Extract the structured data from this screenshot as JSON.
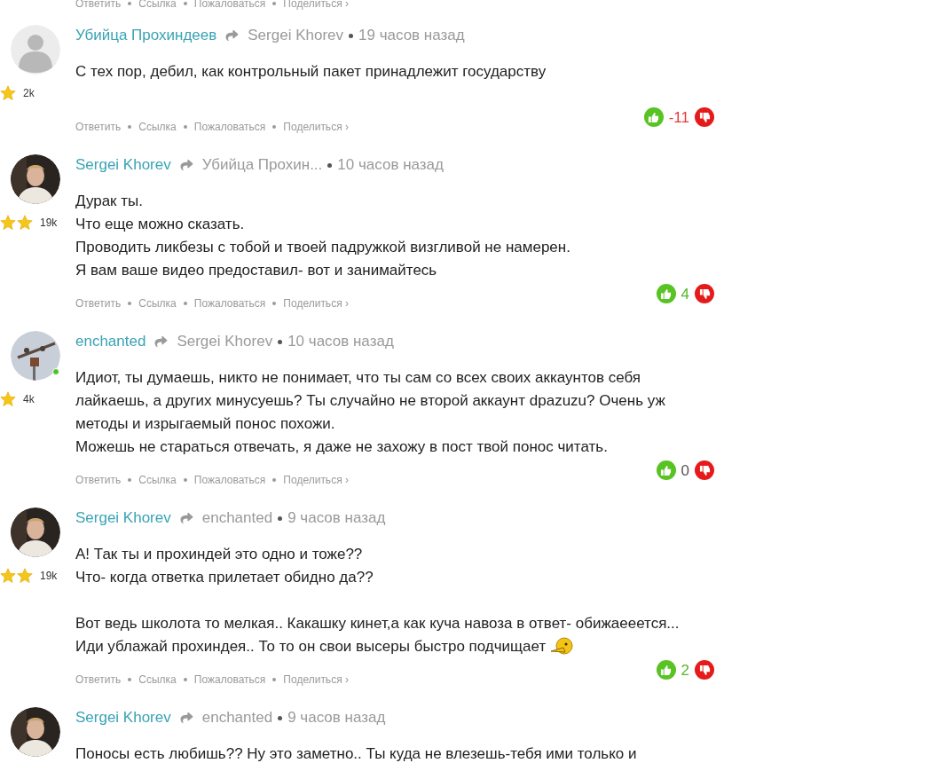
{
  "top_actions": [
    "Ответить",
    "Ссылка",
    "Пожаловаться",
    "Поделиться ›"
  ],
  "comments": [
    {
      "author": "Убийца Прохиндеев",
      "reply_to": "Sergei Khorev",
      "time": "19 часов назад",
      "avatar": {
        "kind": "placeholder"
      },
      "online": false,
      "double_star": false,
      "rating": "2k",
      "paragraphs": [
        [
          "С тех пор, дебил, как контрольный пакет принадлежит государству"
        ]
      ],
      "smiley": false,
      "score": "-11",
      "color": "#e53935",
      "actions": [
        "Ответить",
        "Ссылка",
        "Пожаловаться",
        "Поделиться ›"
      ]
    },
    {
      "author": "Sergei Khorev",
      "reply_to": "Убийца Прохин...",
      "time": "10 часов назад",
      "avatar": {
        "kind": "person"
      },
      "online": false,
      "double_star": true,
      "rating": "19k",
      "paragraphs": [
        [
          "Дурак ты.",
          "Что еще можно сказать.",
          "Проводить ликбезы с тобой и твоей падружкой визгливой не намерен.",
          "Я вам ваше видео предоставил- вот и занимайтесь"
        ]
      ],
      "smiley": false,
      "score": "4",
      "color": "#58b72c",
      "actions": [
        "Ответить",
        "Ссылка",
        "Пожаловаться",
        "Поделиться ›"
      ]
    },
    {
      "author": "enchanted",
      "reply_to": "Sergei Khorev",
      "time": "10 часов назад",
      "avatar": {
        "kind": "scene"
      },
      "online": true,
      "double_star": false,
      "rating": "4k",
      "paragraphs": [
        [
          "Идиот, ты думаешь, никто не понимает, что ты сам со всех своих аккаунтов себя лайкаешь, а других минусуешь? Ты случайно не второй аккаунт dpazuzu? Очень уж методы и изрыгаемый понос похожи.",
          "Можешь не стараться отвечать, я даже не захожу в пост твой понос читать."
        ]
      ],
      "smiley": false,
      "score": "0",
      "color": "#555555",
      "actions": [
        "Ответить",
        "Ссылка",
        "Пожаловаться",
        "Поделиться ›"
      ]
    },
    {
      "author": "Sergei Khorev",
      "reply_to": "enchanted",
      "time": "9 часов назад",
      "avatar": {
        "kind": "person"
      },
      "online": false,
      "double_star": true,
      "rating": "19k",
      "paragraphs": [
        [
          "А! Так ты и прохиндей это одно и тоже??",
          "Что- когда ответка прилетает обидно да??"
        ],
        [
          "Вот ведь школота то мелкая.. Какашку кинет,а как куча навоза в ответ- обижаееется...",
          "Иди ублажай прохиндея.. То то он свои высеры быстро подчищает"
        ]
      ],
      "smiley": true,
      "score": "2",
      "color": "#58b72c",
      "actions": [
        "Ответить",
        "Ссылка",
        "Пожаловаться",
        "Поделиться ›"
      ]
    },
    {
      "author": "Sergei Khorev",
      "reply_to": "enchanted",
      "time": "9 часов назад",
      "avatar": {
        "kind": "person"
      },
      "online": false,
      "paragraphs": [
        [
          "Поносы есть любишь?? Ну это заметно.. Ты куда не влезешь-тебя ими только и"
        ]
      ]
    }
  ]
}
